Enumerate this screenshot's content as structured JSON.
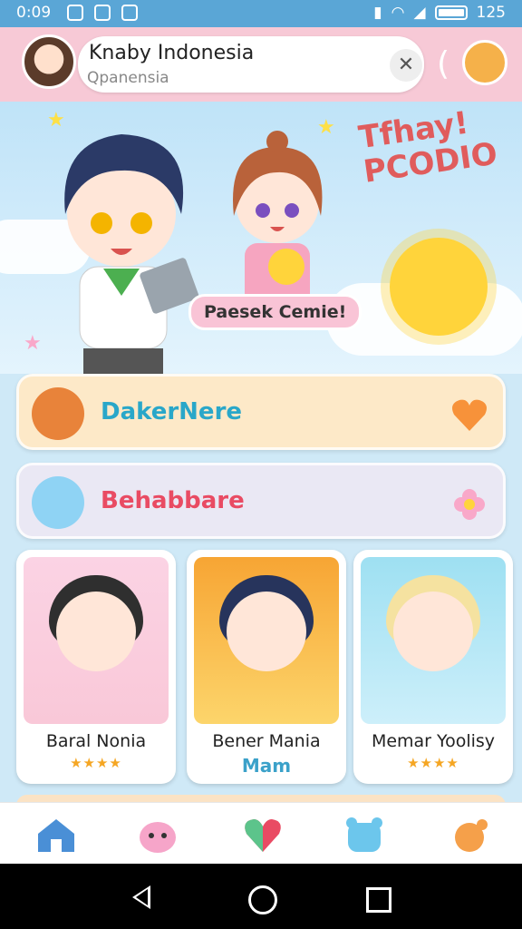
{
  "status_bar": {
    "time": "0:09",
    "battery_level": "125"
  },
  "search": {
    "title": "Knaby Indonesia",
    "subtitle": "Qpanensia"
  },
  "hero": {
    "logo_line1": "Tfhay!",
    "logo_line2": "PCODIO",
    "ribbon_text": "Paesek Cemie!"
  },
  "menu": [
    {
      "label": "DakerNere",
      "color": "#29a7c9",
      "bg": "#fde9c8"
    },
    {
      "label": "Behabbare",
      "color": "#e94b63",
      "bg": "#eae8f4"
    }
  ],
  "cards": [
    {
      "name": "Baral Nonia",
      "rating_stars": "★★★★"
    },
    {
      "name": "Bener Mania",
      "sub_label": "Mam"
    },
    {
      "name": "Memar Yoolisy",
      "rating_stars": "★★★★"
    }
  ],
  "tabs": [
    "home-icon",
    "pink-blob-icon",
    "heart-icon",
    "blue-bear-icon",
    "orange-creature-icon"
  ],
  "colors": {
    "status_bar": "#5aa6d6",
    "top_bar": "#f7c9d6",
    "accent": "#3ba1c9"
  }
}
